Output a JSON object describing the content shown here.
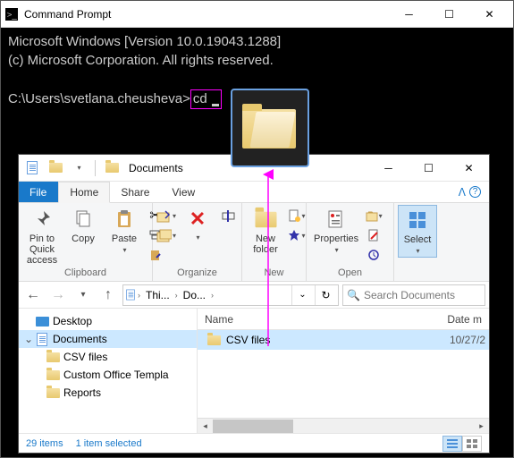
{
  "cmd": {
    "title": "Command Prompt",
    "line1": "Microsoft Windows [Version 10.0.19043.1288]",
    "line2": "(c) Microsoft Corporation. All rights reserved.",
    "prompt": "C:\\Users\\svetlana.cheusheva>",
    "typed": "cd"
  },
  "explorer": {
    "title": "Documents",
    "tabs": {
      "file": "File",
      "home": "Home",
      "share": "Share",
      "view": "View"
    },
    "ribbon": {
      "pin": "Pin to Quick\naccess",
      "copy": "Copy",
      "paste": "Paste",
      "clipboard": "Clipboard",
      "organize": "Organize",
      "new": "New",
      "open": "Open",
      "newfolder": "New\nfolder",
      "properties": "Properties",
      "select": "Select"
    },
    "breadcrumb": {
      "seg1": "Thi...",
      "seg2": "Do..."
    },
    "search_placeholder": "Search Documents",
    "tree": {
      "desktop": "Desktop",
      "documents": "Documents",
      "csv": "CSV files",
      "templ": "Custom Office Templa",
      "reports": "Reports"
    },
    "columns": {
      "name": "Name",
      "date": "Date m"
    },
    "row": {
      "name": "CSV files",
      "date": "10/27/2"
    },
    "status": {
      "items": "29 items",
      "sel": "1 item selected"
    }
  }
}
